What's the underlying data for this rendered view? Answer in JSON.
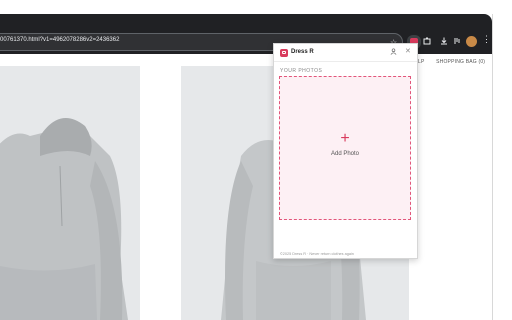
{
  "browser": {
    "url": "00761370.html?v1=4962078286v2=2436362",
    "extension_active_icon": "dress-r-extension-icon",
    "toolbar_icons": [
      "bookmark-star-icon",
      "extension-icon",
      "download-icon",
      "media-icon",
      "profile-avatar-icon",
      "menu-icon"
    ]
  },
  "site": {
    "nav": [
      "LP",
      "SHOPPING BAG (0)"
    ]
  },
  "popup": {
    "brand": "Dress R",
    "section_label": "YOUR PHOTOS",
    "plus": "+",
    "add_label": "Add Photo",
    "footer": "©2025 Dress R · Never return clothes again",
    "accent_color": "#d93b5d"
  }
}
